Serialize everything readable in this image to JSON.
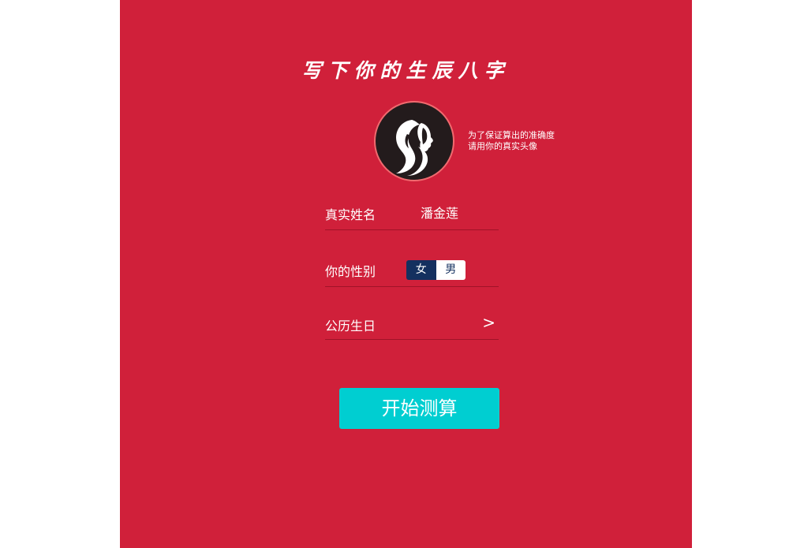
{
  "title": "写下你的生辰八字",
  "avatar": {
    "icon": "woman-silhouette-icon",
    "hint_line1": "为了保证算出的准确度",
    "hint_line2": "请用你的真实头像"
  },
  "form": {
    "name_label": "真实姓名",
    "name_value": "潘金莲",
    "gender_label": "你的性别",
    "gender_options": [
      "女",
      "男"
    ],
    "gender_selected": "女",
    "birthday_label": "公历生日",
    "birthday_chevron": ">"
  },
  "start_button": "开始测算",
  "colors": {
    "background": "#d0203a",
    "button": "#00ced1",
    "toggle_active": "#14305f"
  }
}
